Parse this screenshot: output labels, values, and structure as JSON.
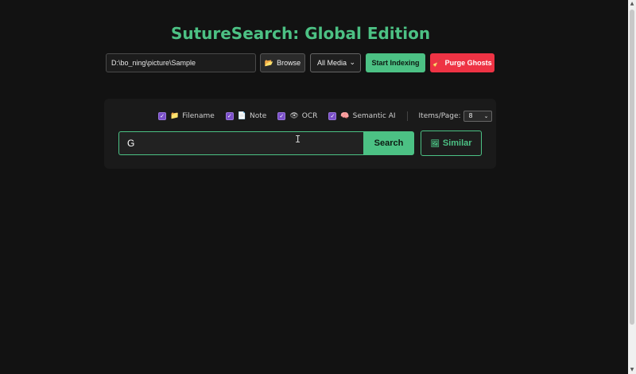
{
  "app": {
    "title": "SutureSearch: Global Edition"
  },
  "toolbar": {
    "path_value": "D:\\bo_ning\\picture\\Sample",
    "browse_label": "Browse",
    "browse_icon": "folder-icon",
    "media_selected": "All Media",
    "index_label": "Start Indexing",
    "purge_label": "Purge Ghosts",
    "purge_icon": "broom-icon"
  },
  "search_options": {
    "items": [
      {
        "label": "Filename",
        "icon": "folder-icon",
        "checked": true
      },
      {
        "label": "Note",
        "icon": "memo-icon",
        "checked": true
      },
      {
        "label": "OCR",
        "icon": "eye-icon",
        "checked": true
      },
      {
        "label": "Semantic AI",
        "icon": "brain-icon",
        "checked": true
      }
    ],
    "items_per_page_label": "Items/Page:",
    "items_per_page_value": "8"
  },
  "search": {
    "query": "G",
    "search_label": "Search",
    "similar_label": "Similar",
    "similar_icon": "image-icon"
  },
  "colors": {
    "accent": "#4cc184",
    "danger": "#ee3344",
    "checkbox": "#7a4ec8",
    "background": "#121212"
  }
}
